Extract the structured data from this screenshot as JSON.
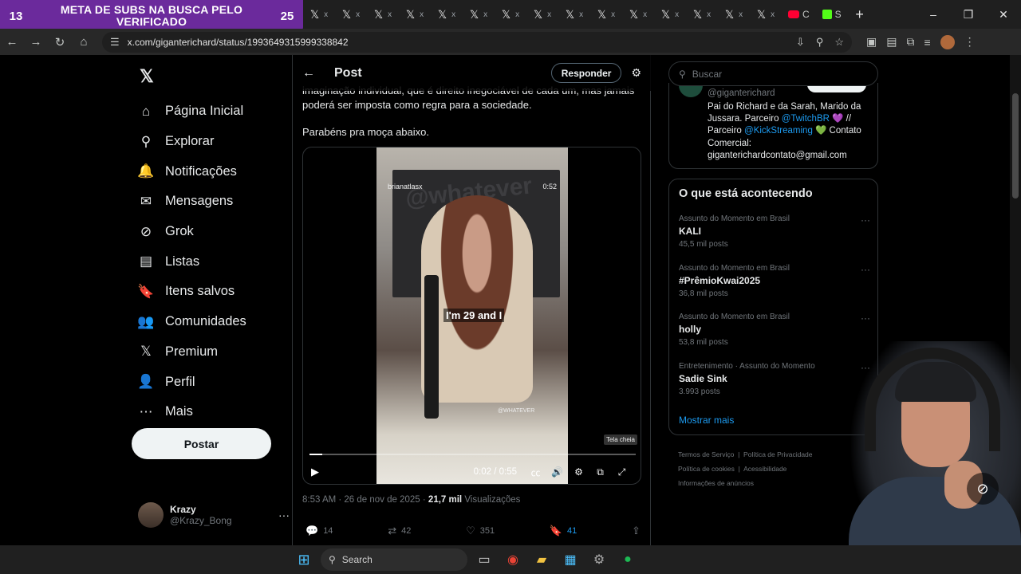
{
  "browser": {
    "overlay": {
      "left_number": "13",
      "message": "META DE SUBS NA BUSCA PELO VERIFICADO",
      "right_number": "25"
    },
    "tab_glyph": "𝕏",
    "tab_close": "x",
    "tab_count": 15,
    "special_tabs": [
      {
        "icon": "youtube-icon",
        "label": "C"
      },
      {
        "icon": "kick-icon",
        "label": "S"
      }
    ],
    "new_tab": "+",
    "url": "x.com/giganterichard/status/1993649315999338842",
    "window_controls": {
      "minimize": "–",
      "maximize": "❐",
      "close": "✕"
    }
  },
  "sidebar": {
    "logo": "𝕏",
    "items": [
      {
        "label": "Página Inicial",
        "icon": "home-icon",
        "glyph": "⌂"
      },
      {
        "label": "Explorar",
        "icon": "search-icon",
        "glyph": "⚲"
      },
      {
        "label": "Notificações",
        "icon": "bell-icon",
        "glyph": "🔔"
      },
      {
        "label": "Mensagens",
        "icon": "mail-icon",
        "glyph": "✉"
      },
      {
        "label": "Grok",
        "icon": "grok-icon",
        "glyph": "⊘"
      },
      {
        "label": "Listas",
        "icon": "list-icon",
        "glyph": "▤"
      },
      {
        "label": "Itens salvos",
        "icon": "bookmark-icon",
        "glyph": "🔖"
      },
      {
        "label": "Comunidades",
        "icon": "communities-icon",
        "glyph": "👥"
      },
      {
        "label": "Premium",
        "icon": "premium-icon",
        "glyph": "𝕏"
      },
      {
        "label": "Perfil",
        "icon": "profile-icon",
        "glyph": "👤"
      },
      {
        "label": "Mais",
        "icon": "more-icon",
        "glyph": "⋯"
      }
    ],
    "post_button": "Postar",
    "account": {
      "name": "Krazy",
      "handle": "@Krazy_Bong",
      "more": "···"
    }
  },
  "main": {
    "header": {
      "title": "Post",
      "reply": "Responder"
    },
    "text_line1": "imaginação individual, que é direito inegociável de cada um, mas jamais",
    "text_line2": "poderá ser imposta como regra para a sociedade.",
    "text_para2": "Parabéns pra moça abaixo.",
    "video": {
      "channel": "brianatlasx",
      "duration_label": "0:52",
      "wall_text": "@whatever",
      "caption": "I'm 29 and I",
      "watermark": "@WHATEVER",
      "tooltip": "Tela cheia",
      "time": "0:02 / 0:55",
      "progress": 0.04
    },
    "meta": {
      "timestamp": "8:53 AM · 26 de nov de 2025 · ",
      "views_count": "21,7 mil",
      "views_label": " Visualizações"
    },
    "actions": {
      "replies": "14",
      "reposts": "42",
      "likes": "351",
      "bookmarks": "41"
    }
  },
  "right": {
    "search_placeholder": "Buscar",
    "profile": {
      "handle": "@giganterichard",
      "bio_text1": "Pai do Richard e da Sarah, Marido da Jussara. Parceiro ",
      "bio_link1": "@TwitchBR",
      "bio_text2": " 💜 // Parceiro ",
      "bio_link2": "@KickStreaming",
      "bio_text3": " 💚 Contato Comercial: giganterichardcontato@gmail.com"
    },
    "trends_title": "O que está acontecendo",
    "trends": [
      {
        "context": "Assunto do Momento em Brasil",
        "name": "KALI",
        "count": "45,5 mil posts"
      },
      {
        "context": "Assunto do Momento em Brasil",
        "name": "#PrêmioKwai2025",
        "count": "36,8 mil posts"
      },
      {
        "context": "Assunto do Momento em Brasil",
        "name": "holly",
        "count": "53,8 mil posts"
      },
      {
        "context": "Entretenimento · Assunto do Momento",
        "name": "Sadie Sink",
        "count": "3.993 posts"
      }
    ],
    "show_more": "Mostrar mais",
    "footer": [
      "Termos de Serviço",
      "Política de Privacidade",
      "Política de cookies",
      "Acessibilidade",
      "Informações de anúncios"
    ]
  },
  "taskbar": {
    "search": "Search"
  }
}
